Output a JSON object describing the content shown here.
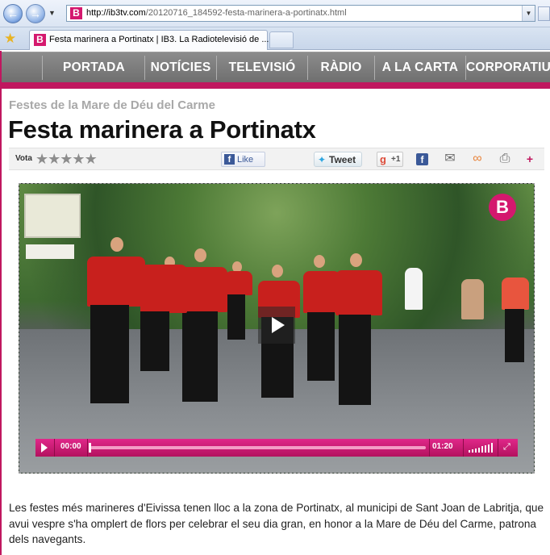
{
  "browser": {
    "url_host": "http://ib3tv.com",
    "url_path": "/20120716_184592-festa-marinera-a-portinatx.html",
    "tab_title": "Festa marinera a Portinatx | IB3. La Radiotelevisió de ...",
    "favicon_letter": "B"
  },
  "site_nav": {
    "items": [
      "PORTADA",
      "NOTÍCIES",
      "TELEVISIÓ",
      "RÀDIO",
      "A LA CARTA",
      "CORPORATIU"
    ]
  },
  "article": {
    "kicker": "Festes de la Mare de Déu del Carme",
    "title": "Festa marinera a Portinatx",
    "body": "Les festes més marineres d'Eivissa tenen lloc a la zona de Portinatx, al municipi de Sant Joan de Labritja, que avui vespre s'ha omplert de flors per celebrar el seu dia gran, en honor a la Mare de Déu del Carme, patrona dels navegants."
  },
  "share_bar": {
    "vote_label": "Vota",
    "rating_stars": 5,
    "rating_value": 0,
    "fb_like_label": "Like",
    "tweet_label": "Tweet",
    "gplus_label": "+1"
  },
  "video": {
    "current_time": "00:00",
    "duration": "01:20",
    "progress": 0,
    "channel_logo": "B"
  },
  "colors": {
    "brand_magenta": "#c0175f",
    "nav_gray": "#7d7d7d"
  }
}
